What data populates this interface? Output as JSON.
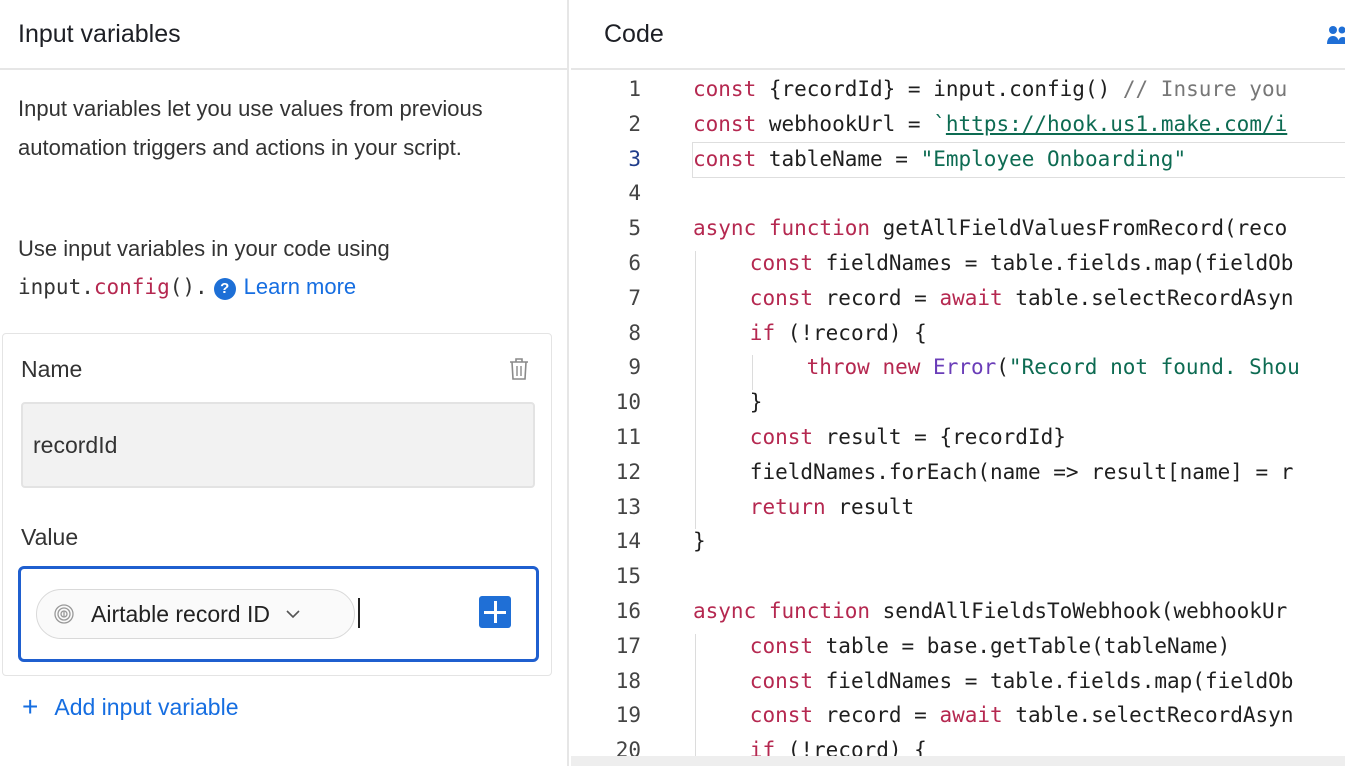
{
  "left_panel": {
    "title": "Input variables",
    "description": "Input variables let you use values from previous automation triggers and actions in your script.",
    "usage_prefix": "Use input variables in your code using",
    "code_input": "input.",
    "code_config": "config",
    "code_suffix": "().",
    "learn_more": "Learn more",
    "variable": {
      "name_label": "Name",
      "name_value": "recordId",
      "value_label": "Value",
      "value_token": "Airtable record ID"
    },
    "add_variable": "Add input variable"
  },
  "right_panel": {
    "title": "Code",
    "active_line": 3,
    "lines": [
      {
        "n": "1",
        "indent": 0,
        "parts": [
          [
            "k",
            "const"
          ],
          [
            "t",
            " {recordId} = input.config() "
          ],
          [
            "c",
            "// Insure you"
          ]
        ]
      },
      {
        "n": "2",
        "indent": 0,
        "parts": [
          [
            "k",
            "const"
          ],
          [
            "t",
            " webhookUrl = "
          ],
          [
            "s",
            "`"
          ],
          [
            "u",
            "https://hook.us1.make.com/i"
          ]
        ]
      },
      {
        "n": "3",
        "indent": 0,
        "parts": [
          [
            "k",
            "const"
          ],
          [
            "t",
            " tableName = "
          ],
          [
            "s",
            "\"Employee Onboarding\""
          ]
        ]
      },
      {
        "n": "4",
        "indent": 0,
        "parts": []
      },
      {
        "n": "5",
        "indent": 0,
        "parts": [
          [
            "k",
            "async function"
          ],
          [
            "t",
            " getAllFieldValuesFromRecord(reco"
          ]
        ]
      },
      {
        "n": "6",
        "indent": 1,
        "parts": [
          [
            "k",
            "const"
          ],
          [
            "t",
            " fieldNames = table.fields.map(fieldOb"
          ]
        ]
      },
      {
        "n": "7",
        "indent": 1,
        "parts": [
          [
            "k",
            "const"
          ],
          [
            "t",
            " record = "
          ],
          [
            "k",
            "await"
          ],
          [
            "t",
            " table.selectRecordAsyn"
          ]
        ]
      },
      {
        "n": "8",
        "indent": 1,
        "parts": [
          [
            "k",
            "if"
          ],
          [
            "t",
            " (!record) {"
          ]
        ]
      },
      {
        "n": "9",
        "indent": 2,
        "parts": [
          [
            "k",
            "throw new"
          ],
          [
            "t",
            " "
          ],
          [
            "f",
            "Error"
          ],
          [
            "t",
            "("
          ],
          [
            "s",
            "\"Record not found. Shou"
          ]
        ]
      },
      {
        "n": "10",
        "indent": 1,
        "parts": [
          [
            "t",
            "}"
          ]
        ]
      },
      {
        "n": "11",
        "indent": 1,
        "parts": [
          [
            "k",
            "const"
          ],
          [
            "t",
            " result = {recordId}"
          ]
        ]
      },
      {
        "n": "12",
        "indent": 1,
        "parts": [
          [
            "t",
            "fieldNames.forEach(name => result[name] = r"
          ]
        ]
      },
      {
        "n": "13",
        "indent": 1,
        "parts": [
          [
            "k",
            "return"
          ],
          [
            "t",
            " result"
          ]
        ]
      },
      {
        "n": "14",
        "indent": 0,
        "parts": [
          [
            "t",
            "}"
          ]
        ]
      },
      {
        "n": "15",
        "indent": 0,
        "parts": []
      },
      {
        "n": "16",
        "indent": 0,
        "parts": [
          [
            "k",
            "async function"
          ],
          [
            "t",
            " sendAllFieldsToWebhook(webhookUr"
          ]
        ]
      },
      {
        "n": "17",
        "indent": 1,
        "parts": [
          [
            "k",
            "const"
          ],
          [
            "t",
            " table = base.getTable(tableName)"
          ]
        ]
      },
      {
        "n": "18",
        "indent": 1,
        "parts": [
          [
            "k",
            "const"
          ],
          [
            "t",
            " fieldNames = table.fields.map(fieldOb"
          ]
        ]
      },
      {
        "n": "19",
        "indent": 1,
        "parts": [
          [
            "k",
            "const"
          ],
          [
            "t",
            " record = "
          ],
          [
            "k",
            "await"
          ],
          [
            "t",
            " table.selectRecordAsyn"
          ]
        ]
      },
      {
        "n": "20",
        "indent": 1,
        "parts": [
          [
            "k",
            "if"
          ],
          [
            "t",
            " (!record) {"
          ]
        ]
      }
    ]
  },
  "colors": {
    "accent": "#166ee1",
    "keyword": "#b52850",
    "string": "#0d6b52"
  }
}
